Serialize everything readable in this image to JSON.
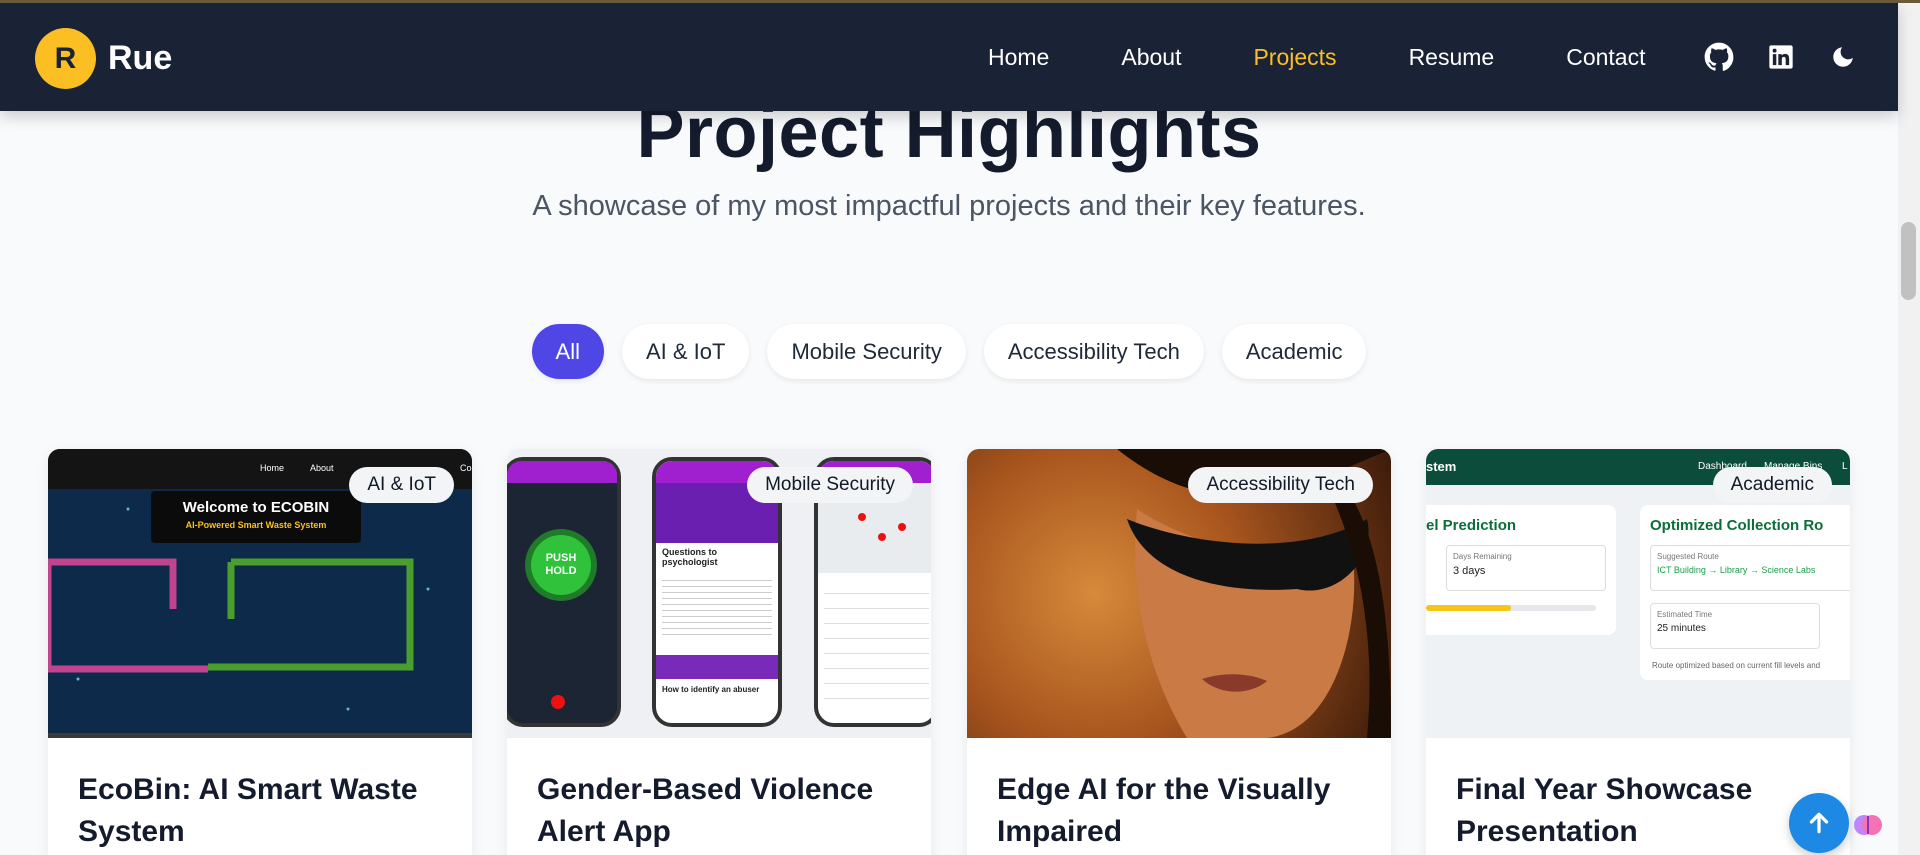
{
  "nav": {
    "logo_letter": "R",
    "brand": "Rue",
    "links": [
      "Home",
      "About",
      "Projects",
      "Resume",
      "Contact"
    ],
    "active": "Projects",
    "icons": [
      "github-icon",
      "linkedin-icon",
      "moon-icon"
    ]
  },
  "hero": {
    "title": "Project Highlights",
    "subtitle": "A showcase of my most impactful projects and their key features."
  },
  "filters": {
    "items": [
      "All",
      "AI & IoT",
      "Mobile Security",
      "Accessibility Tech",
      "Academic"
    ],
    "active": "All"
  },
  "cards": [
    {
      "title": "EcoBin: AI Smart Waste System",
      "badge": "AI & IoT",
      "image": {
        "nav_home": "Home",
        "nav_about": "About",
        "nav_c": "Co",
        "welcome": "Welcome to ECOBIN",
        "tagline": "AI-Powered Smart Waste System"
      }
    },
    {
      "title": "Gender-Based Violence Alert App",
      "badge": "Mobile Security",
      "image": {
        "push_hold": "PUSH HOLD",
        "questions": "Questions to psychologist",
        "abuser": "How to identify an abuser"
      }
    },
    {
      "title": "Edge AI for the Visually Impaired",
      "badge": "Accessibility Tech"
    },
    {
      "title": "Final Year Showcase Presentation",
      "badge": "Academic",
      "image": {
        "header_left": "stem",
        "header_dash": "Dashboard",
        "header_manage": "Manage Bins",
        "header_l": "L",
        "panel1_title": "el Prediction",
        "days_label": "Days Remaining",
        "days_value": "3 days",
        "panel2_title": "Optimized Collection Ro",
        "route_label": "Suggested Route",
        "route_value": "ICT Building → Library → Science Labs",
        "time_label": "Estimated Time",
        "time_value": "25 minutes",
        "note": "Route optimized based on current fill levels and"
      }
    }
  ],
  "colors": {
    "nav_bg": "#1a2236",
    "accent": "#fbbf24",
    "filter_active": "#4f46e5",
    "fab": "#1e88e5"
  }
}
